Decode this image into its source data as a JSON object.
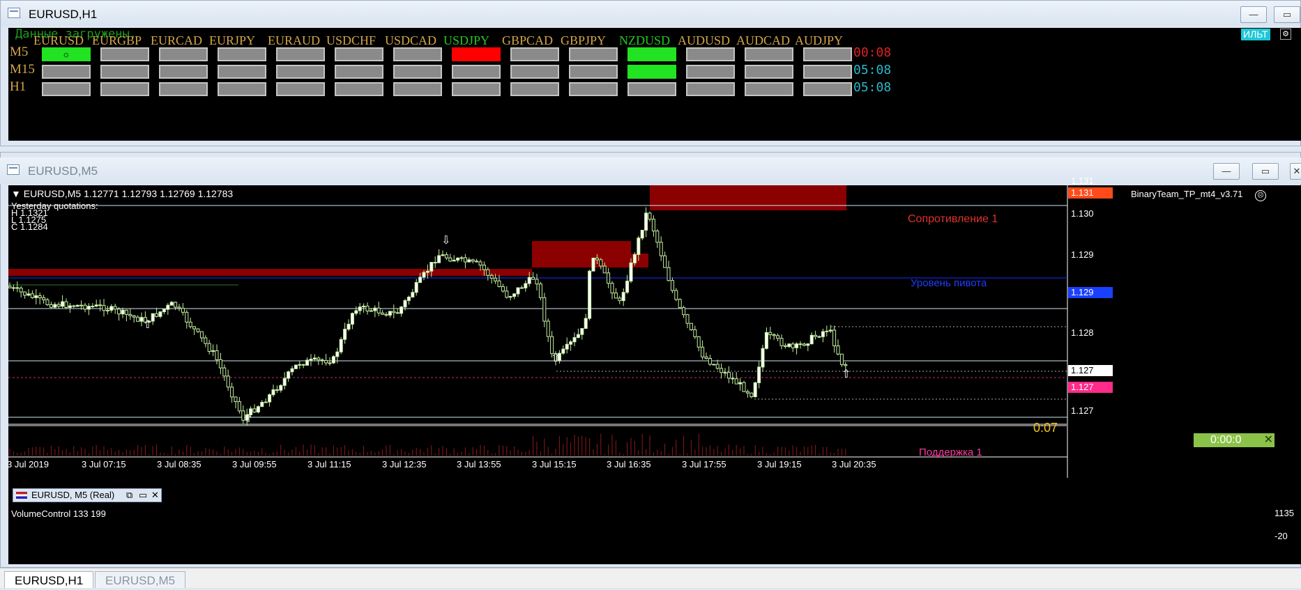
{
  "window_top": {
    "title": "EURUSD,H1"
  },
  "window_chart": {
    "title": "EURUSD,M5"
  },
  "panel": {
    "status": "Данные загружены.",
    "badge": "ИЛЬТ",
    "symbols": [
      {
        "name": "EURUSD",
        "color": "#d4a64a"
      },
      {
        "name": "EURGBP",
        "color": "#d4a64a"
      },
      {
        "name": "EURCAD",
        "color": "#d4a64a"
      },
      {
        "name": "EURJPY",
        "color": "#d4a64a"
      },
      {
        "name": "EURAUD",
        "color": "#d4a64a"
      },
      {
        "name": "USDCHF",
        "color": "#d4a64a"
      },
      {
        "name": "USDCAD",
        "color": "#d4a64a"
      },
      {
        "name": "USDJPY",
        "color": "#22c722"
      },
      {
        "name": "GBPCAD",
        "color": "#d4a64a"
      },
      {
        "name": "GBPJPY",
        "color": "#d4a64a"
      },
      {
        "name": "NZDUSD",
        "color": "#22c722"
      },
      {
        "name": "AUDUSD",
        "color": "#d4a64a"
      },
      {
        "name": "AUDCAD",
        "color": "#d4a64a"
      },
      {
        "name": "AUDJPY",
        "color": "#d4a64a"
      }
    ],
    "rows": [
      {
        "label": "M5",
        "timer": "00:08",
        "timer_color": "#e02020",
        "active": {
          "0": "#22e322",
          "7": "#ff0000",
          "10": "#22e322"
        }
      },
      {
        "label": "M15",
        "timer": "05:08",
        "timer_color": "#2ab7c9",
        "active": {
          "10": "#22e322"
        }
      },
      {
        "label": "H1",
        "timer": "05:08",
        "timer_color": "#2ab7c9",
        "active": {}
      }
    ]
  },
  "chart": {
    "header": "EURUSD,M5  1.12771 1.12793 1.12769 1.12783",
    "indicator_name": "BinaryTeam_TP_mt4_v3.71",
    "yesterday": {
      "title": "Yesterday quotations:",
      "h": "H 1.1321",
      "l": "L 1.1275",
      "c": "C 1.1284"
    },
    "resistance_label": "Сопротивление 1",
    "pivot_label": "Уровень пивота",
    "support_label": "Поддержка 1",
    "countdown": "0:07",
    "timer_badge": "0:00:0",
    "price_labels": [
      {
        "text": "1.131",
        "bg": ""
      },
      {
        "text": "1.131",
        "bg": "#ff4a1a"
      },
      {
        "text": "1.130",
        "bg": ""
      },
      {
        "text": "1.129",
        "bg": ""
      },
      {
        "text": "1.129",
        "bg": "#1a40ff"
      },
      {
        "text": "1.128",
        "bg": ""
      },
      {
        "text": "1.127",
        "bg": "#ffffff"
      },
      {
        "text": "1.127",
        "bg": "#ff2a8a"
      },
      {
        "text": "1.127",
        "bg": ""
      }
    ],
    "volume_label": "VolumeControl 133 199",
    "volume_axis": [
      "1135",
      "-20"
    ],
    "time_labels": [
      "3 Jul 2019",
      "3 Jul 07:15",
      "3 Jul 08:35",
      "3 Jul 09:55",
      "3 Jul 11:15",
      "3 Jul 12:35",
      "3 Jul 13:55",
      "3 Jul 15:15",
      "3 Jul 16:35",
      "3 Jul 17:55",
      "3 Jul 19:15",
      "3 Jul 20:35"
    ],
    "mini_window": "EURUSD, M5 (Real)"
  },
  "tabs": [
    "EURUSD,H1",
    "EURUSD,M5"
  ]
}
